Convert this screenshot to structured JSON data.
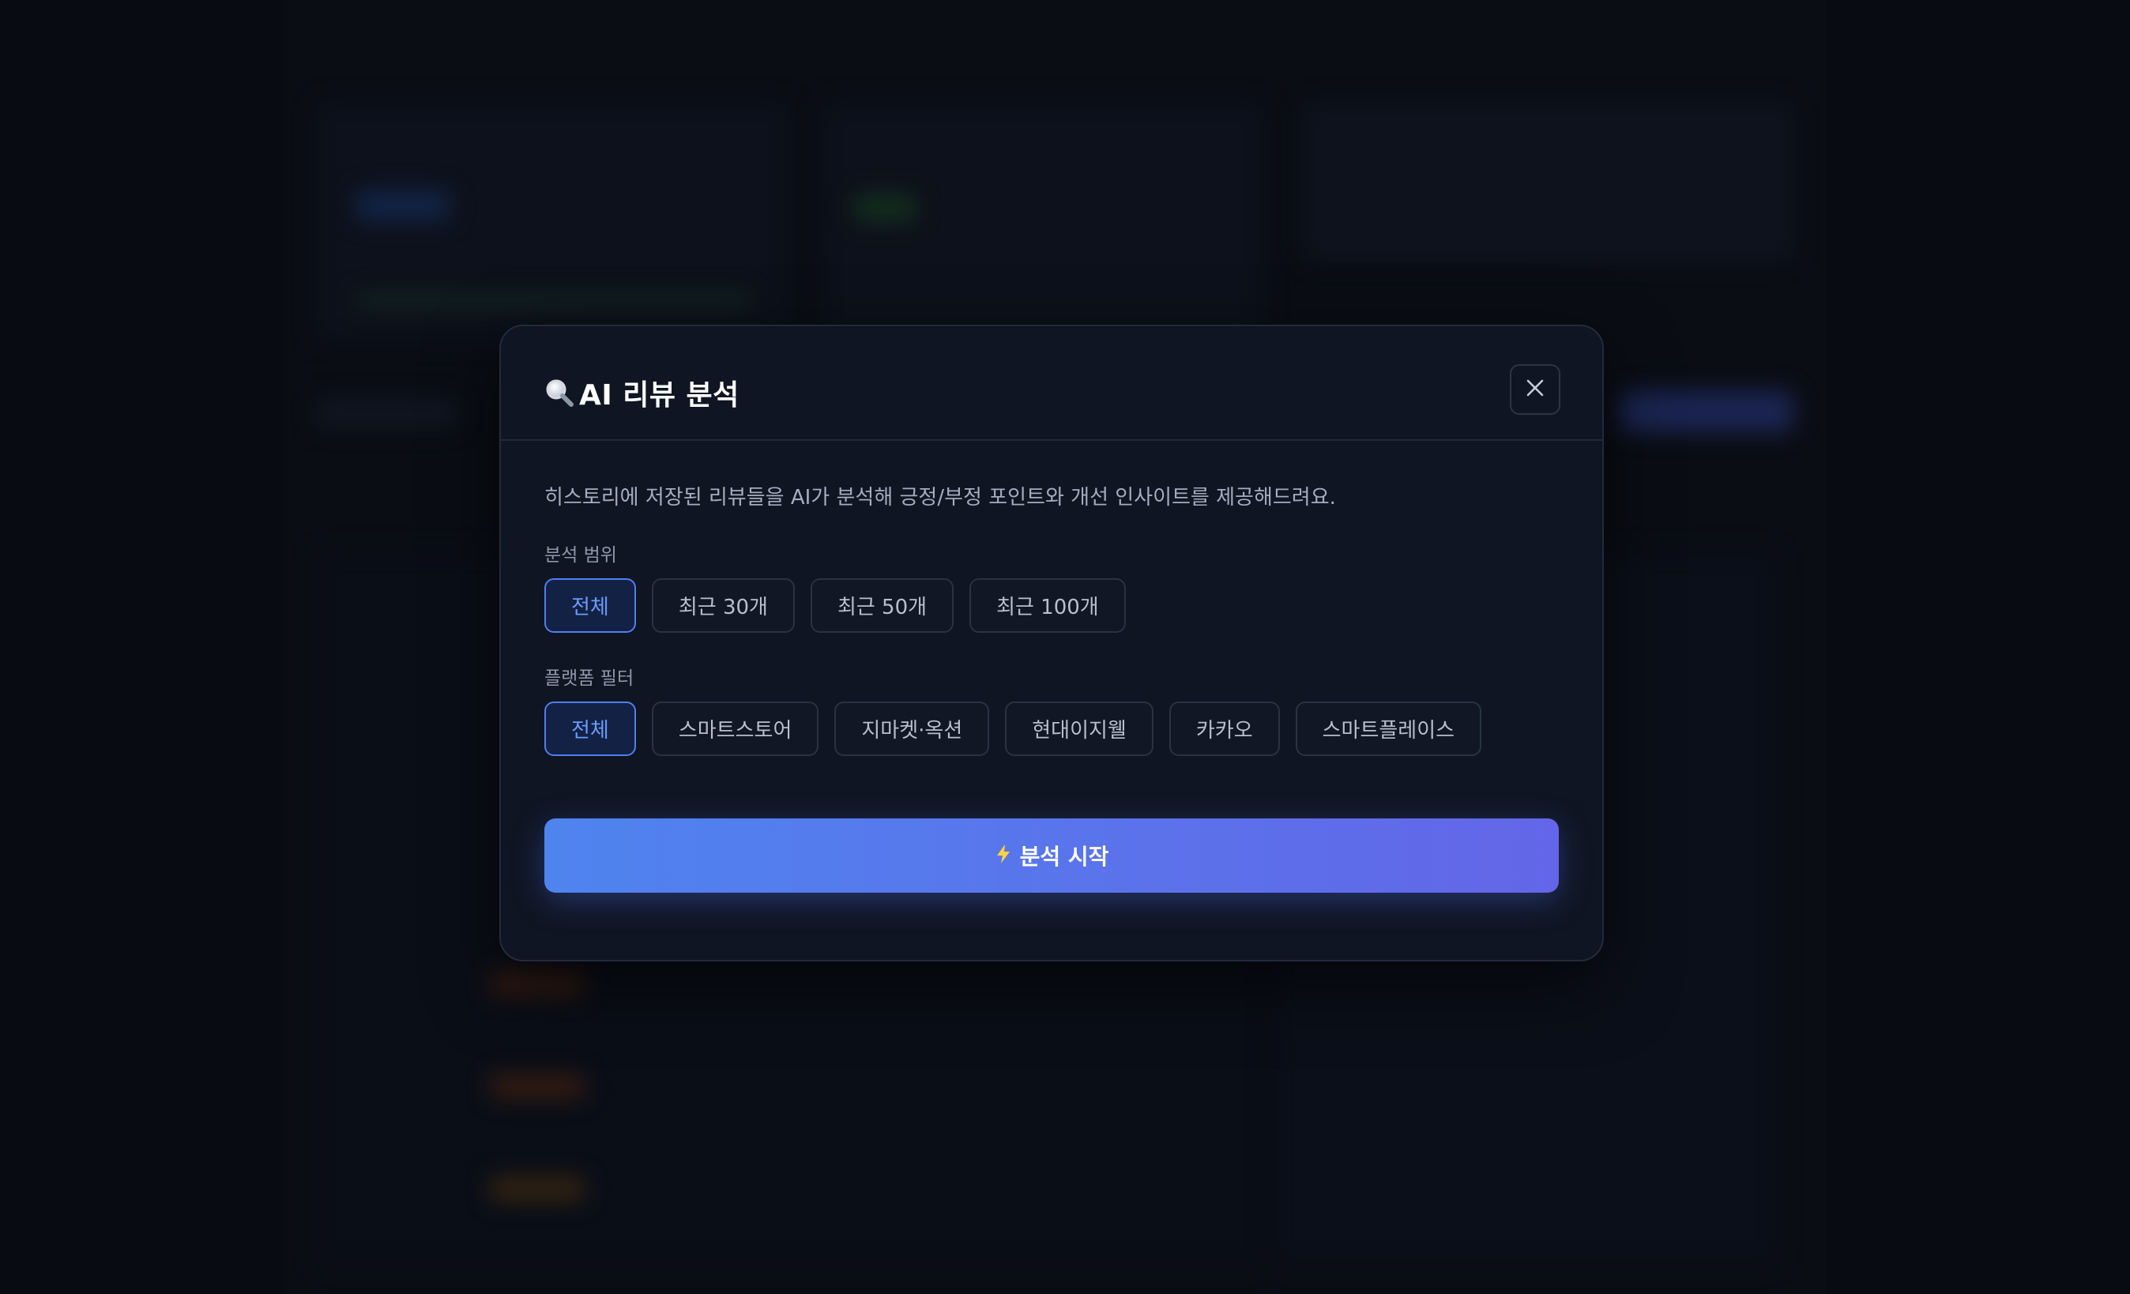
{
  "modal": {
    "title": "AI 리뷰 분석",
    "title_icon": "magnifier-icon",
    "close_icon": "close-icon",
    "description": "히스토리에 저장된 리뷰들을 AI가 분석해 긍정/부정 포인트와 개선 인사이트를 제공해드려요.",
    "scope": {
      "label": "분석 범위",
      "options": [
        "전체",
        "최근 30개",
        "최근 50개",
        "최근 100개"
      ],
      "selected": "전체"
    },
    "platform": {
      "label": "플랫폼 필터",
      "options": [
        "전체",
        "스마트스토어",
        "지마켓·옥션",
        "현대이지웰",
        "카카오",
        "스마트플레이스"
      ],
      "selected": "전체"
    },
    "start_button": {
      "label": "분석 시작",
      "icon": "lightning-icon"
    }
  },
  "colors": {
    "accent": "#4f7ff0",
    "button_gradient_start": "#4f84ef",
    "button_gradient_end": "#6366e8",
    "modal_bg": "#0f1522",
    "page_bg": "#0b0e17"
  }
}
